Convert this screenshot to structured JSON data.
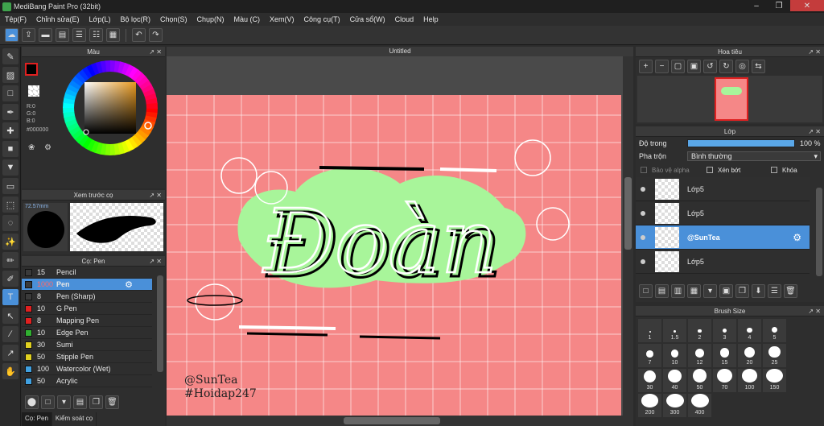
{
  "window": {
    "title": "MediBang Paint Pro (32bit)"
  },
  "menu": [
    "Tệp(F)",
    "Chỉnh sửa(E)",
    "Lớp(L)",
    "Bộ lọc(R)",
    "Chọn(S)",
    "Chụp(N)",
    "Màu (C)",
    "Xem(V)",
    "Công cụ(T)",
    "Cửa sổ(W)",
    "Cloud",
    "Help"
  ],
  "color_panel": {
    "title": "Màu",
    "r": "R:0",
    "g": "G:0",
    "b": "B:0",
    "hex": "#000000",
    "foreground": "#000000",
    "background": "#ffffff",
    "accent": "#e8a020"
  },
  "brush_preview": {
    "title": "Xem trước cọ",
    "size_label": "72.57mm"
  },
  "brush_panel": {
    "title": "Cọ: Pen",
    "items": [
      {
        "size": "15",
        "name": "Pencil",
        "color": "#3a3a3a"
      },
      {
        "size": "1000",
        "name": "Pen",
        "color": "#3a3a3a",
        "selected": true
      },
      {
        "size": "8",
        "name": "Pen (Sharp)",
        "color": "#3a3a3a"
      },
      {
        "size": "10",
        "name": "G Pen",
        "color": "#e02020"
      },
      {
        "size": "8",
        "name": "Mapping Pen",
        "color": "#e02020"
      },
      {
        "size": "10",
        "name": "Edge Pen",
        "color": "#30b030"
      },
      {
        "size": "30",
        "name": "Sumi",
        "color": "#e0d020"
      },
      {
        "size": "50",
        "name": "Stipple Pen",
        "color": "#e0d020"
      },
      {
        "size": "100",
        "name": "Watercolor (Wet)",
        "color": "#40a0e0"
      },
      {
        "size": "50",
        "name": "Acrylic",
        "color": "#40a0e0"
      }
    ],
    "tabs": [
      "Cọ: Pen",
      "Kiểm soát cọ"
    ]
  },
  "document": {
    "title": "Untitled",
    "canvas_color": "#f58787",
    "text_main": "Đoàn",
    "signature_1": "@SunTea",
    "signature_2": "#Hoidap247"
  },
  "navigator": {
    "title": "Hoa tiêu"
  },
  "layer_panel": {
    "title": "Lớp",
    "opacity_label": "Độ trong",
    "opacity_value": "100 %",
    "opacity": 1.0,
    "blend_label": "Pha trộn",
    "blend_value": "Bình thường",
    "protect_alpha": "Bảo vệ alpha",
    "clipping": "Xén bớt",
    "lock": "Khóa",
    "layers": [
      {
        "name": "Lớp5",
        "selected": false
      },
      {
        "name": "Lớp5",
        "selected": false
      },
      {
        "name": "@SunTea",
        "selected": true
      },
      {
        "name": "Lớp5",
        "selected": false
      }
    ]
  },
  "brush_size": {
    "title": "Brush Size",
    "sizes": [
      "1",
      "1.5",
      "2",
      "3",
      "4",
      "5",
      "7",
      "10",
      "12",
      "15",
      "20",
      "25",
      "30",
      "40",
      "50",
      "70",
      "100",
      "150",
      "200",
      "300",
      "400"
    ]
  }
}
